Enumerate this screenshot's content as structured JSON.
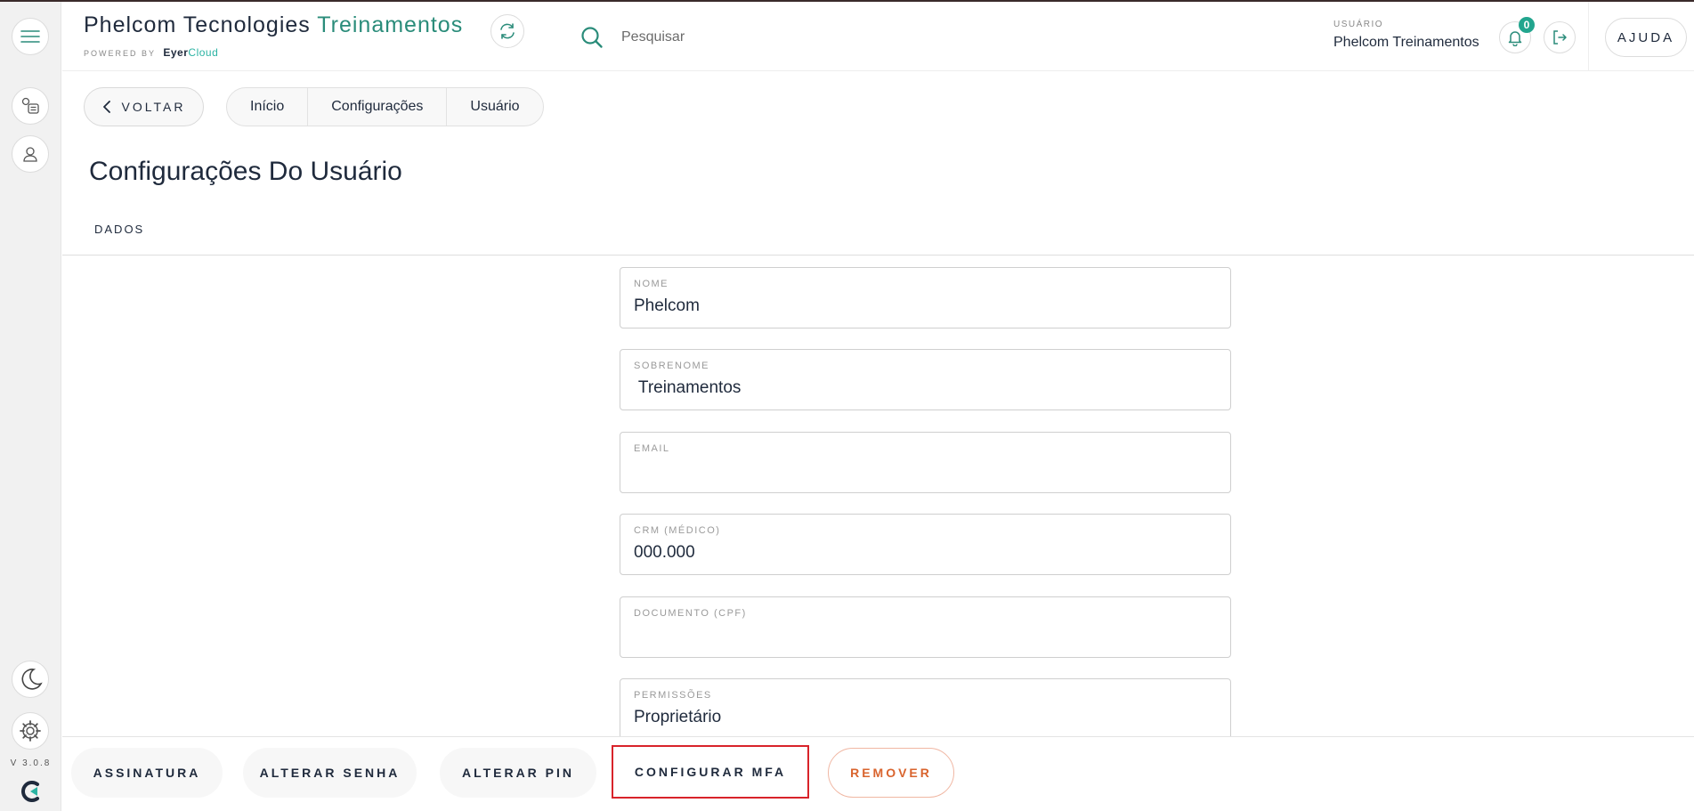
{
  "header": {
    "brand_main": "Phelcom Tecnologies ",
    "brand_accent": "Treinamentos",
    "powered_by": "POWERED BY",
    "powered_eyer": "Eyer",
    "powered_cloud": "Cloud",
    "search_placeholder": "Pesquisar",
    "user_caption": "USUÁRIO",
    "user_name": "Phelcom Treinamentos",
    "notification_count": "0",
    "help_label": "AJUDA"
  },
  "sidebar": {
    "items": [
      {
        "icon": "menu-icon"
      },
      {
        "icon": "clinic-list-icon"
      },
      {
        "icon": "user-icon"
      },
      {
        "icon": "moon-icon"
      },
      {
        "icon": "gear-icon"
      }
    ],
    "version": "V 3.0.8"
  },
  "nav": {
    "back_label": "VOLTAR",
    "breadcrumbs": [
      "Início",
      "Configurações",
      "Usuário"
    ]
  },
  "page": {
    "title": "Configurações Do Usuário",
    "tab": "DADOS"
  },
  "form": {
    "fields": [
      {
        "label": "NOME",
        "value": "Phelcom"
      },
      {
        "label": "SOBRENOME",
        "value": " Treinamentos"
      },
      {
        "label": "EMAIL",
        "value": ""
      },
      {
        "label": "CRM (MÉDICO)",
        "value": "000.000"
      },
      {
        "label": "DOCUMENTO (CPF)",
        "value": ""
      },
      {
        "label": "PERMISSÕES",
        "value": "Proprietário"
      }
    ]
  },
  "actions": {
    "signature": "ASSINATURA",
    "change_password": "ALTERAR SENHA",
    "change_pin": "ALTERAR PIN",
    "configure_mfa": "CONFIGURAR MFA",
    "remove": "REMOVER"
  },
  "colors": {
    "accent": "#2a8c7a",
    "badge": "#22a58e",
    "highlight": "#d8232a",
    "danger": "#d9642e"
  }
}
